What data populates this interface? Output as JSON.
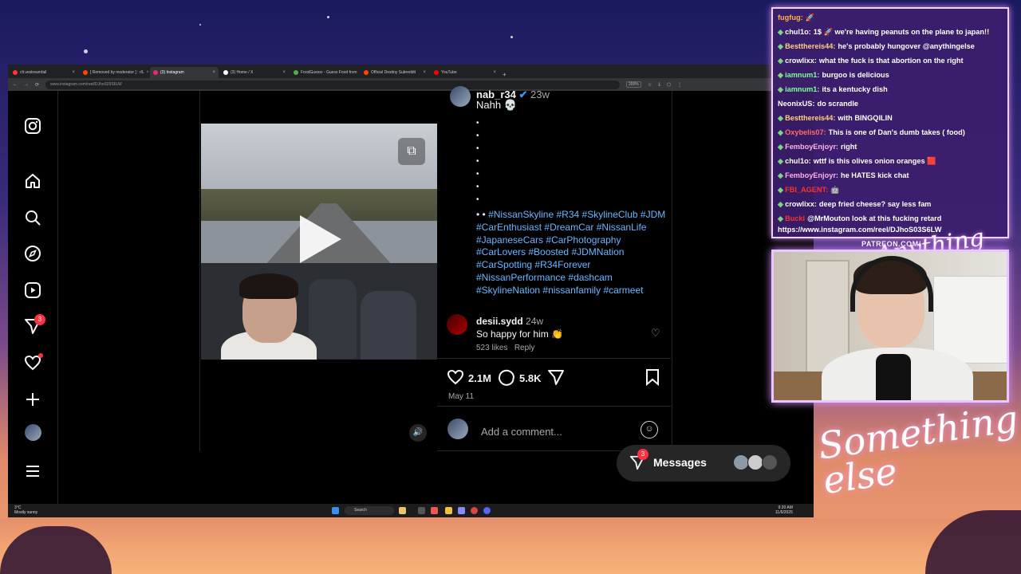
{
  "browser": {
    "tabs": [
      {
        "label": "clt.vestreamfail",
        "active": false,
        "color": "#ff3b30"
      },
      {
        "label": "[ Removed by moderator ] : r/L",
        "active": false,
        "color": "#ff4500"
      },
      {
        "label": "(3) Instagram",
        "active": true,
        "color": "#e1306c"
      },
      {
        "label": "(3) Home / X",
        "active": false,
        "color": "#ffffff"
      },
      {
        "label": "FoodGuessr - Guess Food from",
        "active": false,
        "color": "#4caf50"
      },
      {
        "label": "Official Destiny Subreddit",
        "active": false,
        "color": "#ff4500"
      },
      {
        "label": "YouTube",
        "active": false,
        "color": "#ff0000"
      }
    ],
    "url": "www.instagram.com/reel/DJhoS03S6LW",
    "zoom": "200%"
  },
  "nav": {
    "notifications_badge": "3",
    "icons": [
      "instagram-logo-icon",
      "home-icon",
      "search-icon",
      "explore-icon",
      "reels-icon",
      "messages-icon",
      "heart-icon",
      "create-icon",
      "profile-avatar",
      "menu-icon"
    ]
  },
  "post": {
    "author": "nab_r34",
    "time": "23w",
    "caption": "Nahh 💀",
    "bullet_lines": [
      "•",
      "•",
      "•",
      "•",
      "•",
      "•",
      "•"
    ],
    "hashtag_prefix": "• •",
    "hashtags": [
      "#NissanSkyline",
      "#R34",
      "#SkylineClub",
      "#JDM",
      "#CarEnthusiast",
      "#DreamCar",
      "#NissanLife",
      "#JapaneseCars",
      "#CarPhotography",
      "#CarLovers",
      "#Boosted",
      "#JDMNation",
      "#CarSpotting",
      "#R34Forever",
      "#NissanPerformance",
      "#dashcam",
      "#SkylineNation",
      "#nissanfamily",
      "#carmeet"
    ],
    "comment": {
      "user": "desii.sydd",
      "time": "24w",
      "text": "So happy for him 👏",
      "likes": "523 likes",
      "reply": "Reply"
    },
    "likes": "2.1M",
    "comments": "5.8K",
    "date": "May 11",
    "add_comment_placeholder": "Add a comment..."
  },
  "messages": {
    "label": "Messages",
    "badge": "3"
  },
  "taskbar": {
    "weather_temp": "3°C",
    "weather_desc": "Mostly sunny",
    "search": "Search",
    "time": "9:20 AM",
    "date": "11/6/2025"
  },
  "chat": {
    "lines": [
      {
        "user": "fugfug:",
        "color": "#ffb347",
        "text": "🚀",
        "gem": false
      },
      {
        "user": "chul1o:",
        "color": "#ffffff",
        "text": "1$ 🚀 we're having peanuts on the plane to japan!!",
        "gem": true
      },
      {
        "user": "Bestthereis44:",
        "color": "#ffd27a",
        "text": "he's probably hungover @anythingelse",
        "gem": true
      },
      {
        "user": "crowlixx:",
        "color": "#ffffff",
        "text": "what the fuck is that abortion on the right",
        "gem": true
      },
      {
        "user": "iamnum1:",
        "color": "#7dff9a",
        "text": "burgoo is delicious",
        "gem": true
      },
      {
        "user": "iamnum1:",
        "color": "#7dff9a",
        "text": "its a kentucky dish",
        "gem": true
      },
      {
        "user": "NeonixUS:",
        "color": "#ffffff",
        "text": "do scrandle",
        "gem": false
      },
      {
        "user": "Bestthereis44:",
        "color": "#ffd27a",
        "text": "with BINGQILIN",
        "gem": true
      },
      {
        "user": "Oxybelis07:",
        "color": "#ff6b6b",
        "text": "This is one of Dan's dumb takes ( food)",
        "gem": true
      },
      {
        "user": "FemboyEnjoyr:",
        "color": "#ffb3e6",
        "text": "right",
        "gem": true
      },
      {
        "user": "chul1o:",
        "color": "#ffffff",
        "text": "wttf is this olives onion oranges 🟥",
        "gem": true
      },
      {
        "user": "FemboyEnjoyr:",
        "color": "#ffb3e6",
        "text": "he HATES kick chat",
        "gem": true
      },
      {
        "user": "FBI_AGENT:",
        "color": "#ff3030",
        "text": "🤖",
        "gem": true
      },
      {
        "user": "crowlixx:",
        "color": "#ffffff",
        "text": "deep fried cheese? say less fam",
        "gem": true
      },
      {
        "user": "Bucki",
        "color": "#ff3030",
        "text": "@MrMouton look at this fucking retard",
        "gem": true
      }
    ],
    "url": "https://www.instagram.com/reel/DJhoS03S6LW"
  },
  "overlay": {
    "patreon": "PATREON.COM/",
    "brand_small": "Anything else",
    "brand_large": "Something else"
  }
}
